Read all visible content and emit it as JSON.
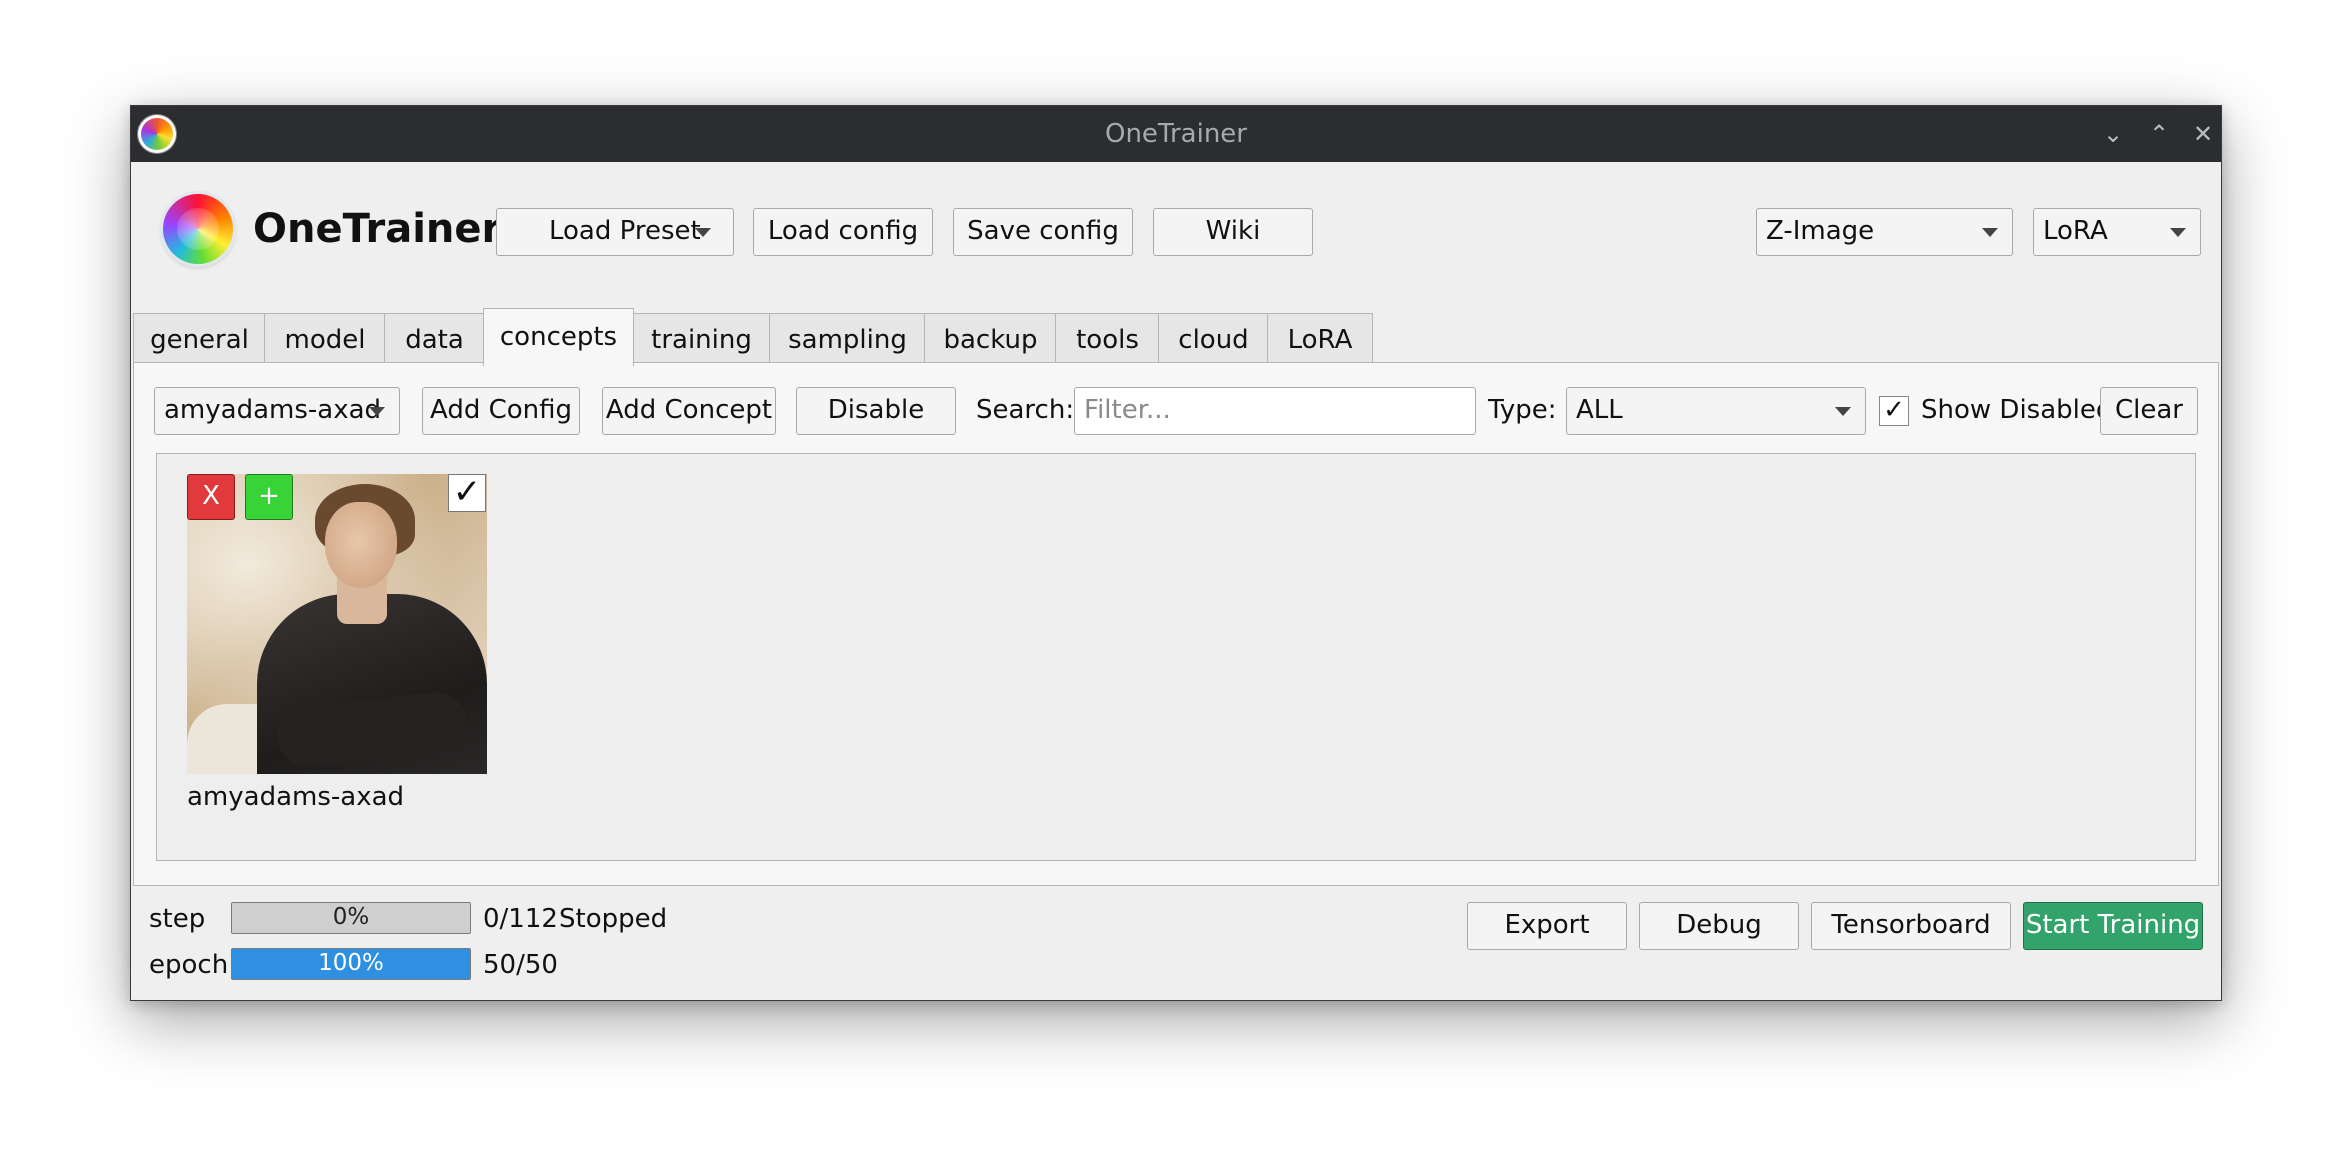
{
  "window": {
    "title": "OneTrainer"
  },
  "header": {
    "brand": "OneTrainer",
    "load_preset": "Load Preset",
    "load_config": "Load config",
    "save_config": "Save config",
    "wiki": "Wiki",
    "model_type": "Z-Image",
    "training_method": "LoRA"
  },
  "tabs": [
    "general",
    "model",
    "data",
    "concepts",
    "training",
    "sampling",
    "backup",
    "tools",
    "cloud",
    "LoRA"
  ],
  "active_tab": "concepts",
  "concepts_toolbar": {
    "config_select": "amyadams-axad",
    "add_config": "Add Config",
    "add_concept": "Add Concept",
    "disable": "Disable",
    "search_label": "Search:",
    "search_placeholder": "Filter...",
    "type_label": "Type:",
    "type_value": "ALL",
    "show_disabled_label": "Show Disabled",
    "show_disabled_checked": "✓",
    "clear": "Clear"
  },
  "concepts": [
    {
      "name": "amyadams-axad",
      "remove": "X",
      "clone": "+",
      "enabled": "✓"
    }
  ],
  "status": {
    "step_label": "step",
    "step_percent": "0%",
    "step_fraction": 0.0,
    "step_count": "0/112",
    "state": "Stopped",
    "epoch_label": "epoch",
    "epoch_percent": "100%",
    "epoch_fraction": 1.0,
    "epoch_count": "50/50"
  },
  "footer": {
    "export": "Export",
    "debug": "Debug",
    "tensorboard": "Tensorboard",
    "start_training": "Start Training"
  },
  "colors": {
    "titlebar": "#2b2d30",
    "remove_button": "#e2393c",
    "clone_button": "#37d337",
    "progress": "#2f8fe0",
    "start_training": "#32a36a"
  }
}
